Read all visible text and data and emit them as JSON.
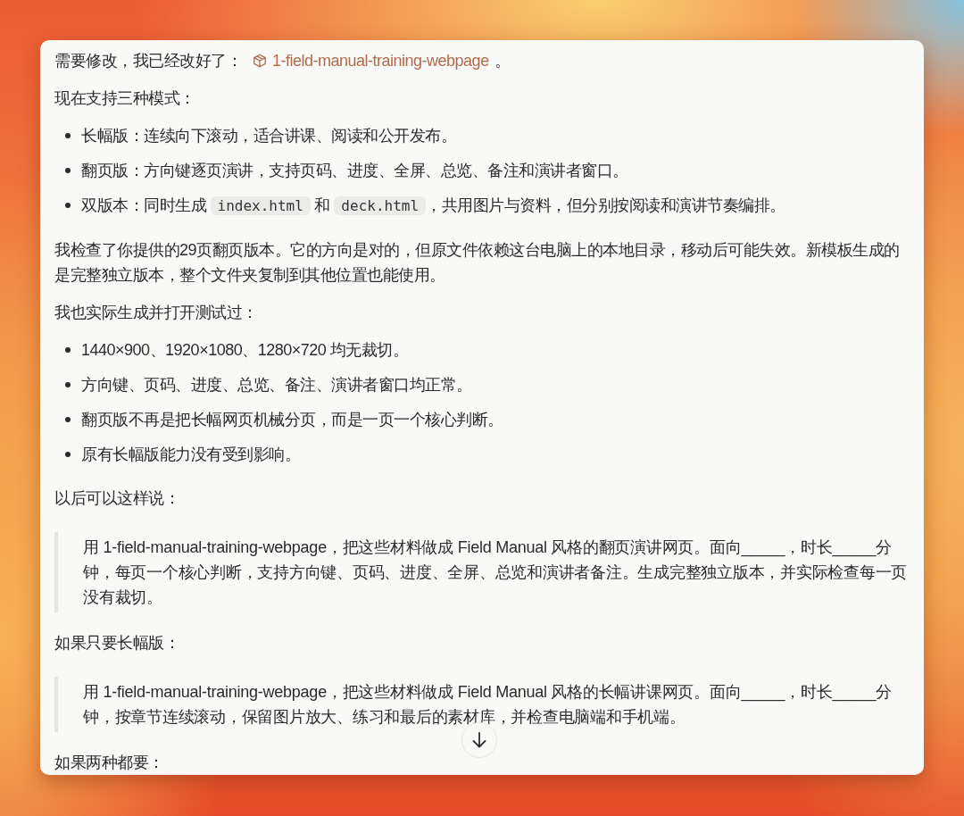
{
  "message": {
    "blocks": [
      {
        "kind": "paragraph",
        "parts": [
          {
            "kind": "text",
            "text": "需要修改，我已经改好了："
          },
          {
            "kind": "link",
            "text": "1-field-manual-training-webpage"
          },
          {
            "kind": "text",
            "text": "。"
          }
        ]
      },
      {
        "kind": "paragraph",
        "parts": [
          {
            "kind": "text",
            "text": "现在支持三种模式："
          }
        ]
      },
      {
        "kind": "list",
        "items": [
          {
            "parts": [
              {
                "kind": "text",
                "text": "长幅版：连续向下滚动，适合讲课、阅读和公开发布。"
              }
            ]
          },
          {
            "parts": [
              {
                "kind": "text",
                "text": "翻页版：方向键逐页演讲，支持页码、进度、全屏、总览、备注和演讲者窗口。"
              }
            ]
          },
          {
            "parts": [
              {
                "kind": "text",
                "text": "双版本：同时生成 "
              },
              {
                "kind": "code",
                "text": "index.html"
              },
              {
                "kind": "text",
                "text": " 和 "
              },
              {
                "kind": "code",
                "text": "deck.html"
              },
              {
                "kind": "text",
                "text": "，共用图片与资料，但分别按阅读和演讲节奏编排。"
              }
            ]
          }
        ]
      },
      {
        "kind": "paragraph",
        "parts": [
          {
            "kind": "text",
            "text": "我检查了你提供的29页翻页版本。它的方向是对的，但原文件依赖这台电脑上的本地目录，移动后可能失效。新模板生成的是完整独立版本，整个文件夹复制到其他位置也能使用。"
          }
        ]
      },
      {
        "kind": "paragraph",
        "parts": [
          {
            "kind": "text",
            "text": "我也实际生成并打开测试过："
          }
        ]
      },
      {
        "kind": "list",
        "items": [
          {
            "parts": [
              {
                "kind": "text",
                "text": "1440×900、1920×1080、1280×720 均无裁切。"
              }
            ]
          },
          {
            "parts": [
              {
                "kind": "text",
                "text": "方向键、页码、进度、总览、备注、演讲者窗口均正常。"
              }
            ]
          },
          {
            "parts": [
              {
                "kind": "text",
                "text": "翻页版不再是把长幅网页机械分页，而是一页一个核心判断。"
              }
            ]
          },
          {
            "parts": [
              {
                "kind": "text",
                "text": "原有长幅版能力没有受到影响。"
              }
            ]
          }
        ]
      },
      {
        "kind": "paragraph",
        "parts": [
          {
            "kind": "text",
            "text": "以后可以这样说："
          }
        ]
      },
      {
        "kind": "quote",
        "text": "用 1-field-manual-training-webpage，把这些材料做成 Field Manual 风格的翻页演讲网页。面向_____，时长_____分钟，每页一个核心判断，支持方向键、页码、进度、全屏、总览和演讲者备注。生成完整独立版本，并实际检查每一页没有裁切。"
      },
      {
        "kind": "paragraph",
        "parts": [
          {
            "kind": "text",
            "text": "如果只要长幅版："
          }
        ]
      },
      {
        "kind": "quote",
        "text": "用 1-field-manual-training-webpage，把这些材料做成 Field Manual 风格的长幅讲课网页。面向_____，时长_____分钟，按章节连续滚动，保留图片放大、练习和最后的素材库，并检查电脑端和手机端。"
      },
      {
        "kind": "paragraph",
        "parts": [
          {
            "kind": "text",
            "text": "如果两种都要："
          }
        ]
      }
    ]
  }
}
